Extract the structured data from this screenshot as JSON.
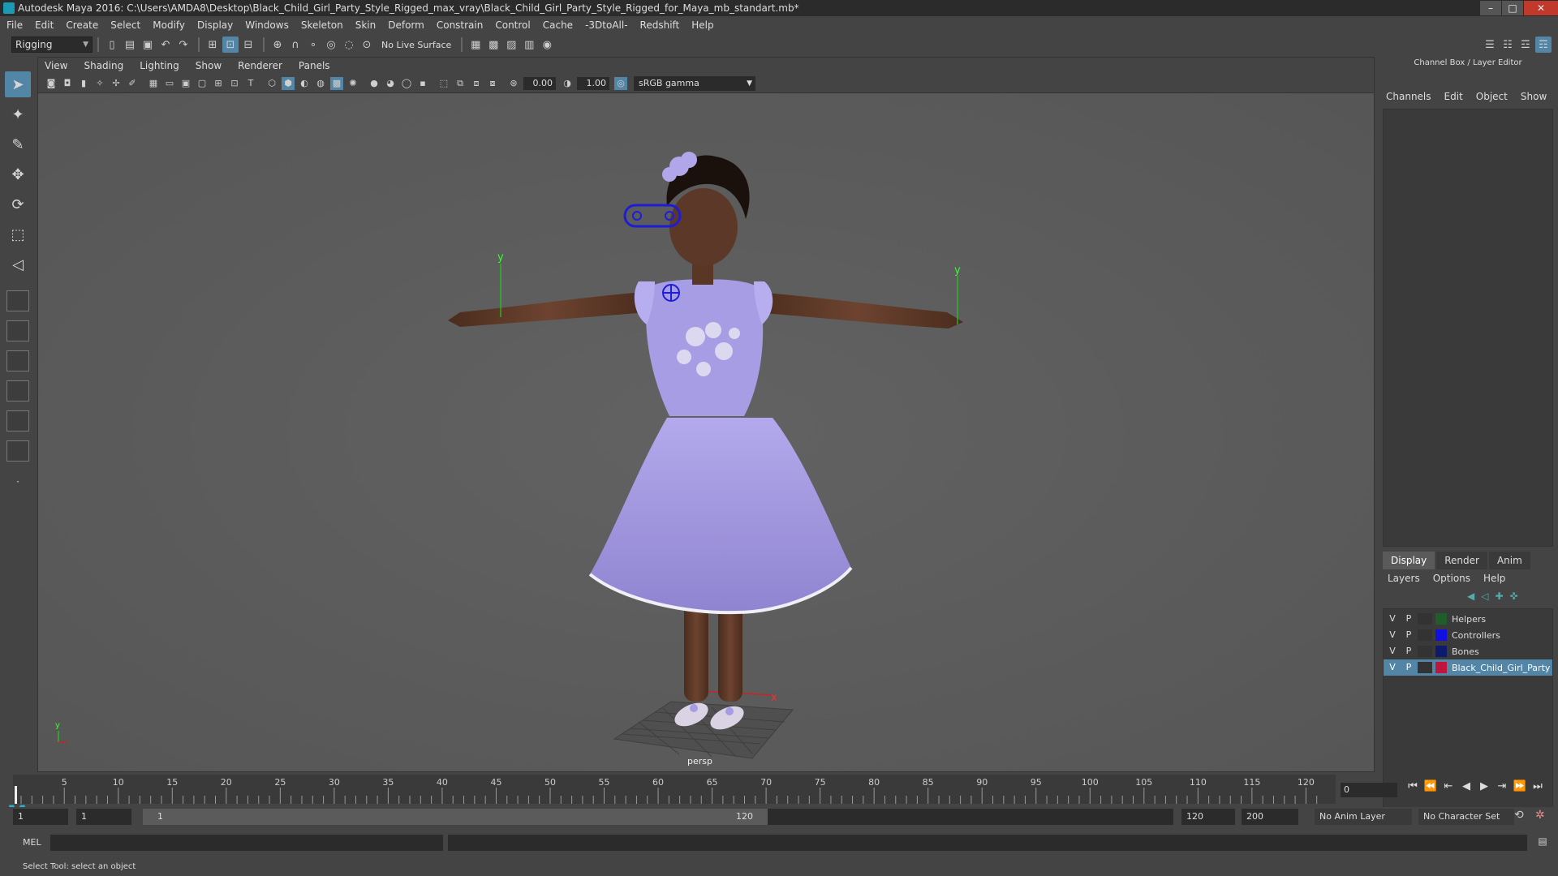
{
  "window": {
    "title": "Autodesk Maya 2016: C:\\Users\\AMDA8\\Desktop\\Black_Child_Girl_Party_Style_Rigged_max_vray\\Black_Child_Girl_Party_Style_Rigged_for_Maya_mb_standart.mb*",
    "minimize": "–",
    "maximize": "□",
    "close": "✕"
  },
  "menubar": {
    "items": [
      "File",
      "Edit",
      "Create",
      "Select",
      "Modify",
      "Display",
      "Windows",
      "Skeleton",
      "Skin",
      "Deform",
      "Constrain",
      "Control",
      "Cache",
      "-3DtoAll-",
      "Redshift",
      "Help"
    ]
  },
  "statusline": {
    "menuset": "Rigging",
    "live_surface": "No Live Surface"
  },
  "viewport": {
    "panel_menu": [
      "View",
      "Shading",
      "Lighting",
      "Show",
      "Renderer",
      "Panels"
    ],
    "exposure": "0.00",
    "gamma_value": "1.00",
    "color_space": "sRGB gamma",
    "camera": "persp",
    "axis_x": "x",
    "axis_y": "y"
  },
  "rightpanel": {
    "header": "Channel Box / Layer Editor",
    "cb_tabs": [
      "Channels",
      "Edit",
      "Object",
      "Show"
    ],
    "le_tabs": [
      "Display",
      "Render",
      "Anim"
    ],
    "le_menu": [
      "Layers",
      "Options",
      "Help"
    ],
    "layers": [
      {
        "v": "V",
        "p": "P",
        "name": "Helpers",
        "color": "#1f5e2a",
        "selected": false
      },
      {
        "v": "V",
        "p": "P",
        "name": "Controllers",
        "color": "#1010e0",
        "selected": false
      },
      {
        "v": "V",
        "p": "P",
        "name": "Bones",
        "color": "#0d1a6e",
        "selected": false
      },
      {
        "v": "V",
        "p": "P",
        "name": "Black_Child_Girl_Party",
        "color": "#c0143c",
        "selected": true
      }
    ]
  },
  "timeslider": {
    "labels": [
      "5",
      "10",
      "15",
      "20",
      "25",
      "30",
      "35",
      "40",
      "45",
      "50",
      "55",
      "60",
      "65",
      "70",
      "75",
      "80",
      "85",
      "90",
      "95",
      "100",
      "105",
      "110",
      "115",
      "120"
    ],
    "current_frame": "0"
  },
  "rangebar": {
    "start": "1",
    "playback_start": "1",
    "range_inner_start": "1",
    "range_inner_end": "120",
    "playback_end": "120",
    "end": "200",
    "anim_layer": "No Anim Layer",
    "character_set": "No Character Set"
  },
  "commandline": {
    "label": "MEL"
  },
  "helpline": {
    "text": "Select Tool: select an object"
  },
  "colors": {
    "accent": "#5285a6",
    "dress": "#a59be0",
    "skin": "#5a3624",
    "controller": "#1d1dd8"
  }
}
